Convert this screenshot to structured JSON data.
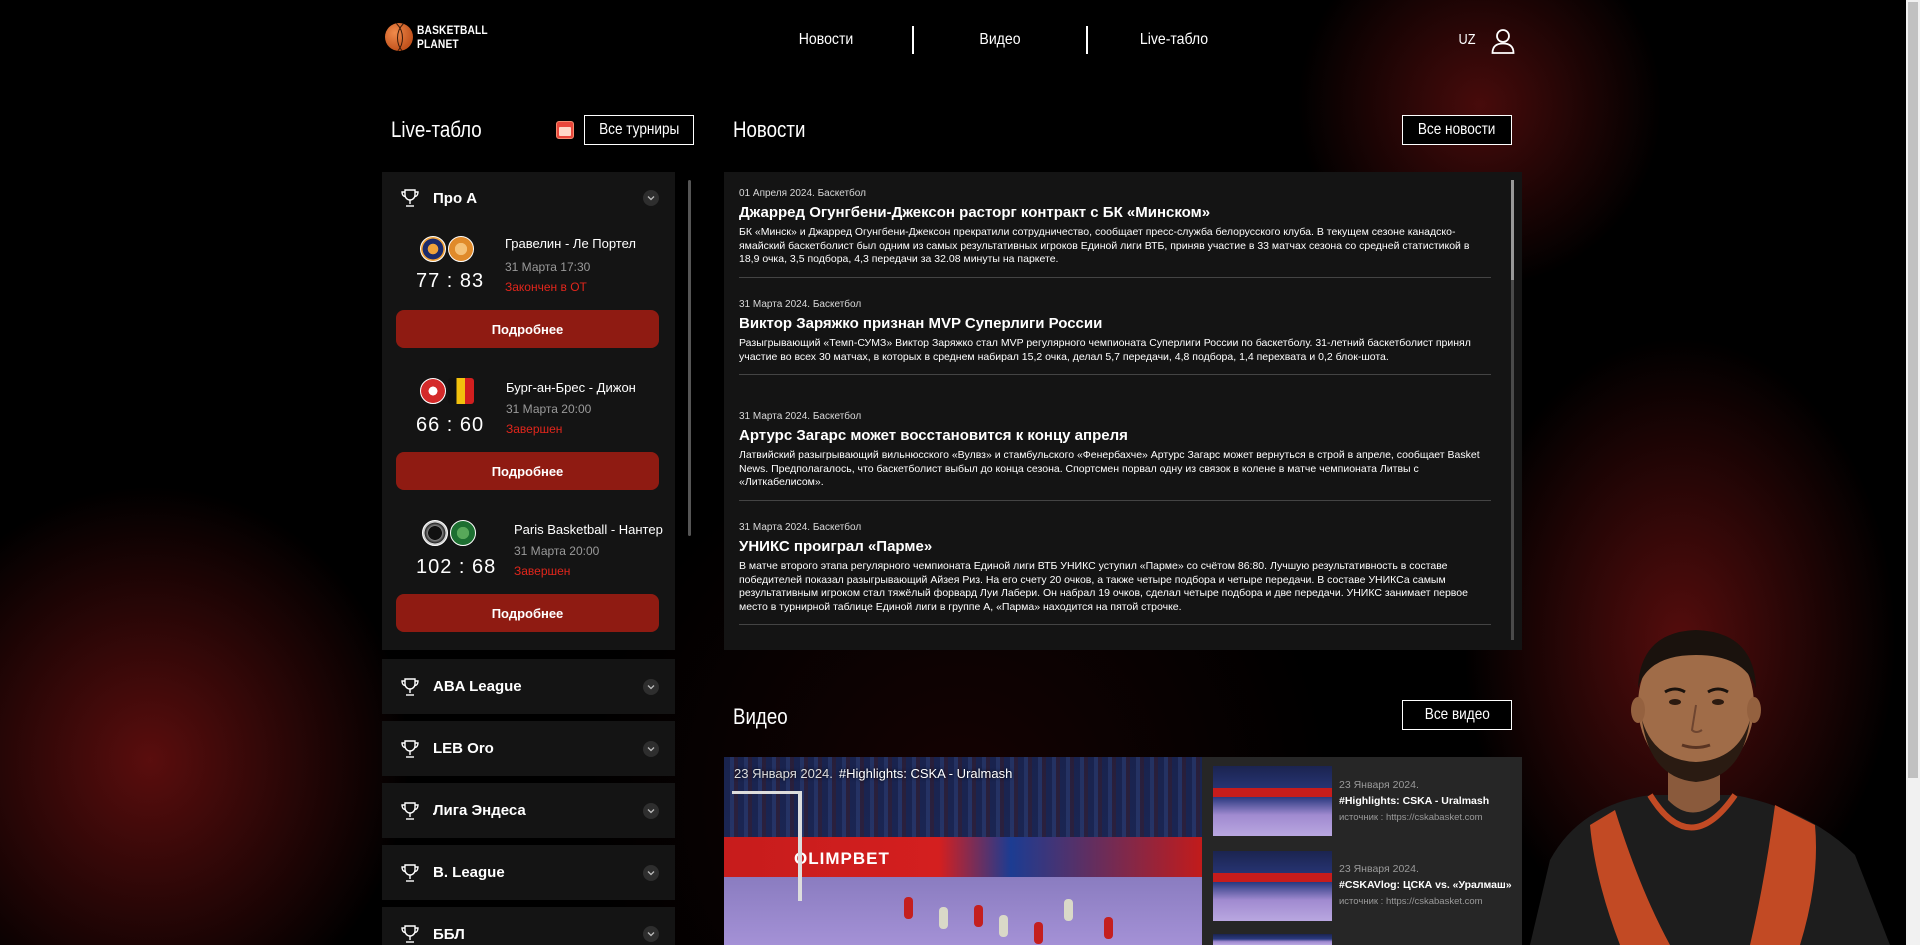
{
  "header": {
    "logo_line1": "BASKETBALL",
    "logo_line2": "PLANET",
    "nav": [
      "Новости",
      "Видео",
      "Live-табло"
    ],
    "lang": "UZ"
  },
  "live": {
    "title": "Live-табло",
    "all_tournaments": "Все турниры",
    "expanded_league": "Про А",
    "matches": [
      {
        "teams": "Гравелин - Ле Портел",
        "date": "31 Марта 17:30",
        "score": "77 : 83",
        "status": "Закончен в ОТ",
        "button": "Подробнее"
      },
      {
        "teams": "Бург-ан-Брес - Дижон",
        "date": "31 Марта 20:00",
        "score": "66 : 60",
        "status": "Завершен",
        "button": "Подробнее"
      },
      {
        "teams": "Paris Basketball - Нантер",
        "date": "31 Марта 20:00",
        "score": "102 : 68",
        "status": "Завершен",
        "button": "Подробнее"
      }
    ],
    "leagues": [
      "ABA League",
      "LEB Oro",
      "Лига Эндеса",
      "B. League",
      "ББЛ"
    ]
  },
  "news": {
    "title": "Новости",
    "all_button": "Все новости",
    "items": [
      {
        "meta": "01 Апреля 2024. Баскетбол",
        "title": "Джарред Огунгбени-Джексон расторг контракт с БК «Минском»",
        "text": "БК «Минск» и Джарред Огунгбени-Джексон прекратили сотрудничество, сообщает пресс-служба белорусского клуба. В текущем сезоне канадско-ямайский баскетболист был одним из самых результативных игроков Единой лиги ВТБ, приняв участие в 33 матчах сезона со средней статистикой в 18,9 очка, 3,5 подбора, 4,3 передачи за 32.08 минуты на паркете."
      },
      {
        "meta": "31 Марта 2024. Баскетбол",
        "title": "Виктор Заряжко признан MVP Суперлиги России",
        "text": "Разыгрывающий «Темп-СУМЗ» Виктор Заряжко стал MVP регулярного чемпионата Суперлиги России по баскетболу. 31-летний баскетболист принял участие во всех 30 матчах, в которых в среднем набирал 15,2 очка, делал 5,7 передачи, 4,8 подбора, 1,4 перехвата и 0,2 блок-шота."
      },
      {
        "meta": "31 Марта 2024. Баскетбол",
        "title": "Артурс Загарс может восстановится к концу апреля",
        "text": "Латвийский разыгрывающий вильнюсского «Вулвз» и стамбульского «Фенербахче» Артурс Загарс может вернуться в строй в апреле, сообщает Basket News. Предполагалось, что баскетболист выбыл до конца сезона. Спортсмен порвал одну из связок в колене в матче чемпионата Литвы с «Литкабелисом»."
      },
      {
        "meta": "31 Марта 2024. Баскетбол",
        "title": "УНИКС проиграл «Парме»",
        "text": "В матче второго этапа регулярного чемпионата Единой лиги ВТБ УНИКС уступил «Парме» со счётом 86:80. Лучшую результативность в составе победителей показал разыгрывающий Айзея Риз. На его счету 20 очков, а также четыре подбора и четыре передачи. В составе УНИКСа самым результативным игроком стал тяжёлый форвард Луи Лабери. Он набрал 19 очков, сделал четыре подбора и две передачи. УНИКС занимает первое место в турнирной таблице Единой лиги в группе А, «Парма» находится на пятой строчке."
      }
    ]
  },
  "video": {
    "title": "Видео",
    "all_button": "Все видео",
    "main": {
      "date": "23 Января 2024.",
      "title": "#Highlights: CSKA - Uralmash",
      "banner": "OLIMPBET"
    },
    "list": [
      {
        "date": "23 Января 2024.",
        "title": "#Highlights: CSKA - Uralmash",
        "source": "источник : https://cskabasket.com"
      },
      {
        "date": "23 Января 2024.",
        "title": "#CSKAVlog: ЦСКА vs. «Уралмаш»",
        "source": "источник : https://cskabasket.com"
      }
    ]
  }
}
